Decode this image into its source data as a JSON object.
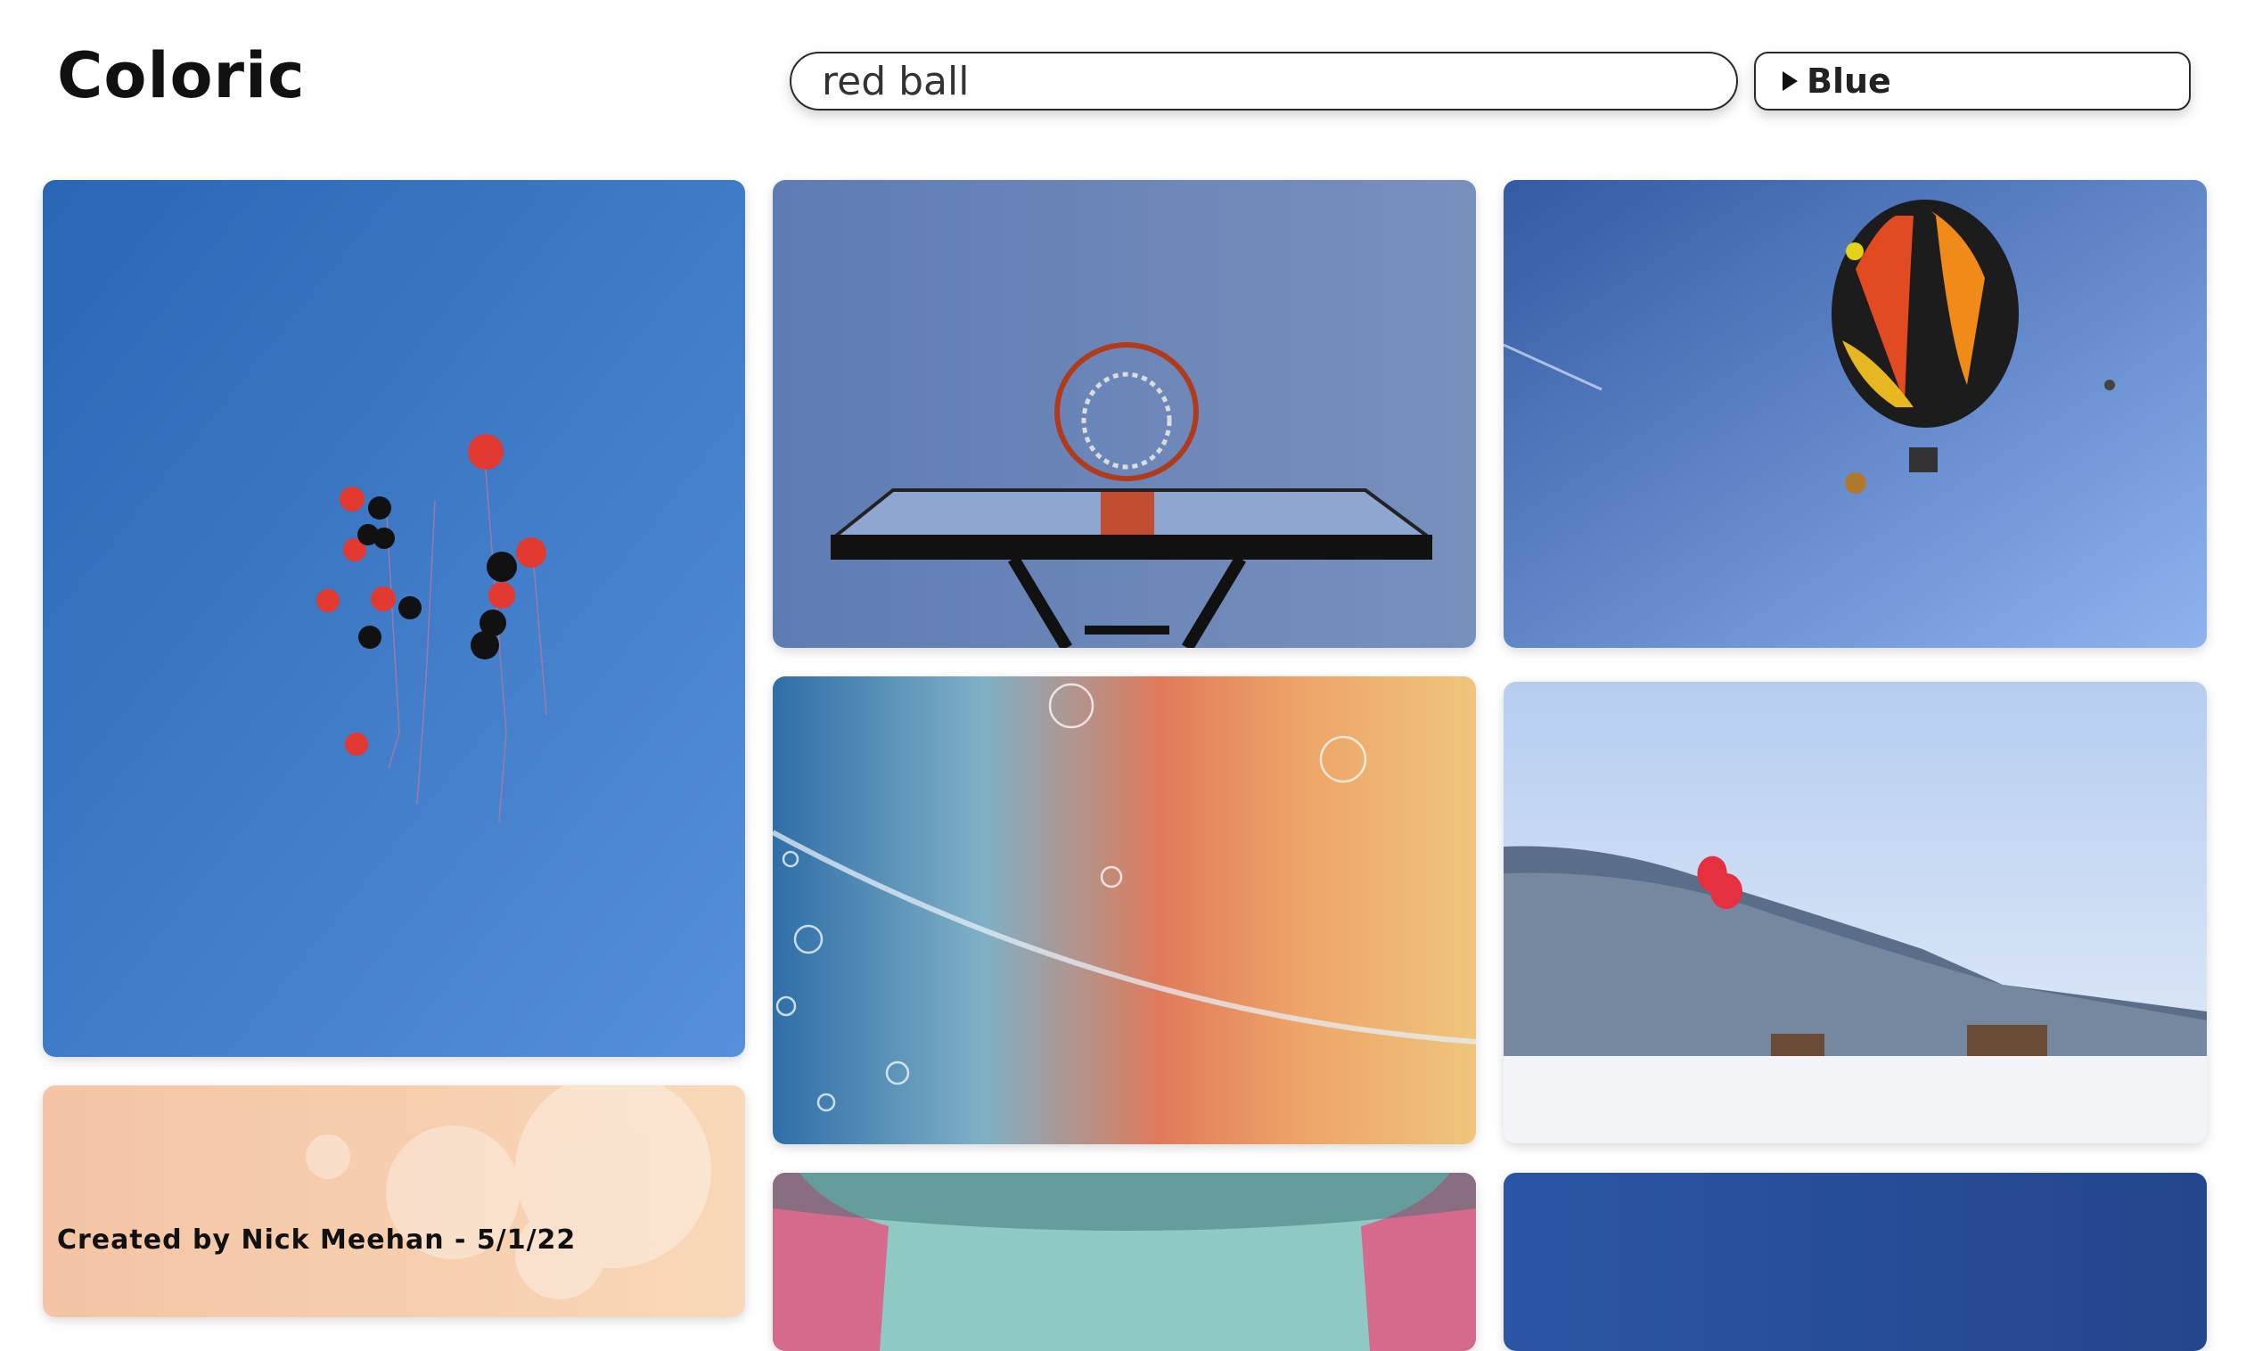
{
  "app": {
    "title": "Coloric"
  },
  "search": {
    "value": "red ball",
    "placeholder": ""
  },
  "color_filter": {
    "selected": "Blue",
    "icon": "caret-right-icon"
  },
  "gallery": {
    "images": [
      "red and black balloons in blue sky",
      "basketball hoop against blue sky",
      "hot air balloon in blue sky",
      "bubbles on blue to orange gradient",
      "red hot air balloon over snowy mountains",
      "peach bubbles",
      "hands on teal background",
      "blue gradient"
    ]
  },
  "footer": {
    "credit": "Created by Nick Meehan - 5/1/22"
  }
}
